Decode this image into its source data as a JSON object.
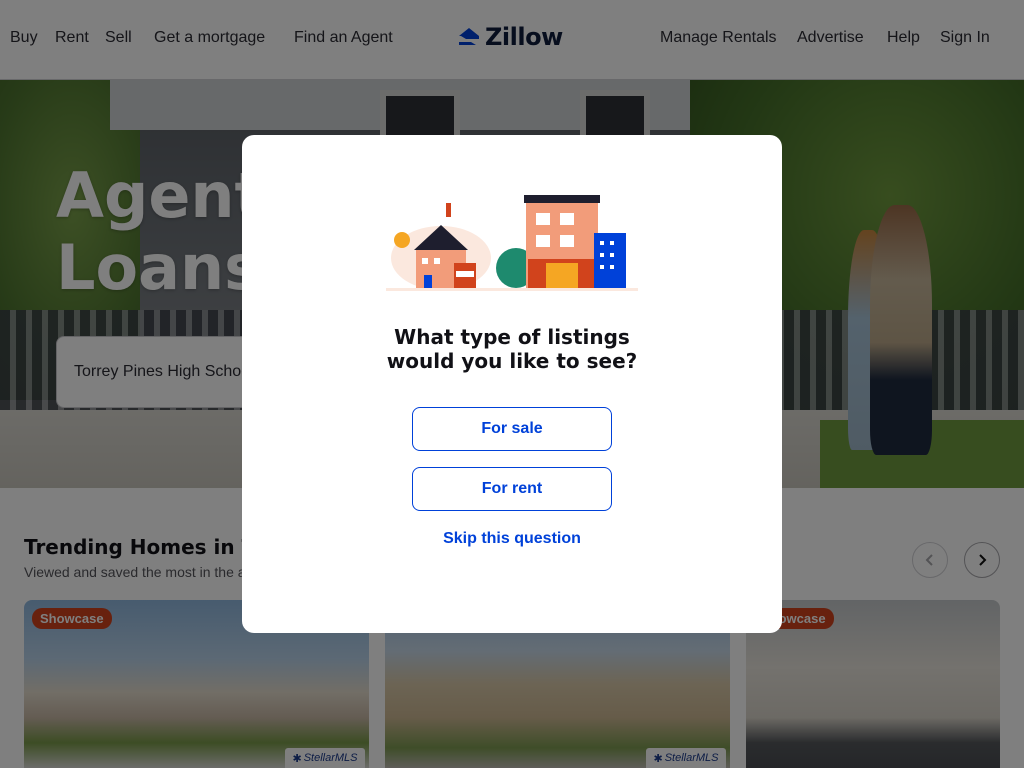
{
  "header": {
    "nav_left": [
      "Buy",
      "Rent",
      "Sell",
      "Get a mortgage",
      "Find an Agent"
    ],
    "logo_text": "Zillow",
    "nav_right": [
      "Manage Rentals",
      "Advertise",
      "Help",
      "Sign In"
    ]
  },
  "hero": {
    "title_line1": "Agents.",
    "title_line2": "Loans.",
    "search_value": "Torrey Pines High School"
  },
  "trending": {
    "title": "Trending Homes in Tampa, FL",
    "subtitle": "Viewed and saved the most in the area over the past 24 hours",
    "cards": [
      {
        "badge": "Showcase",
        "mls": "StellarMLS"
      },
      {
        "badge": "",
        "mls": "StellarMLS"
      },
      {
        "badge": "Showcase",
        "mls": ""
      }
    ]
  },
  "modal": {
    "title_line1": "What type of listings",
    "title_line2": "would you like to see?",
    "for_sale_label": "For sale",
    "for_rent_label": "For rent",
    "skip_label": "Skip this question"
  },
  "colors": {
    "brand_blue": "#0041d9",
    "badge_orange": "#d1431c",
    "overlay": "rgba(0,0,0,0.5)"
  }
}
